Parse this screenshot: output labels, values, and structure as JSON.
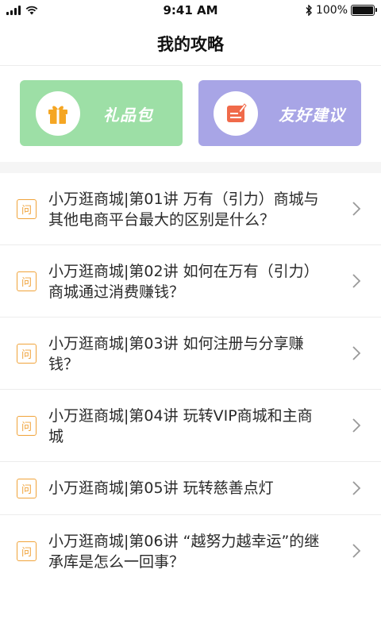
{
  "status": {
    "time": "9:41 AM",
    "battery": "100%"
  },
  "nav": {
    "title": "我的攻略"
  },
  "cards": {
    "gift": {
      "label": "礼品包",
      "icon": "gift-icon"
    },
    "suggest": {
      "label": "友好建议",
      "icon": "note-icon"
    }
  },
  "question_badge": "问",
  "colors": {
    "gift_bg": "#9ddfa6",
    "suggest_bg": "#a8a5e6",
    "accent": "#f0a33a",
    "note_icon": "#f06a4a"
  },
  "articles": [
    {
      "lines": [
        "小万逛商城|第01讲 万有（引力）商城与",
        "其他电商平台最大的区别是什么？"
      ]
    },
    {
      "lines": [
        "小万逛商城|第02讲 如何在万有（引力）",
        "商城通过消费赚钱？"
      ]
    },
    {
      "lines": [
        "小万逛商城|第03讲 如何注册与分享赚",
        "钱？"
      ]
    },
    {
      "lines": [
        "小万逛商城|第04讲 玩转VIP商城和主商",
        "城"
      ]
    },
    {
      "lines": [
        "小万逛商城|第05讲 玩转慈善点灯"
      ]
    },
    {
      "lines": [
        "小万逛商城|第06讲 “越努力越幸运”的继",
        "承库是怎么一回事？"
      ]
    }
  ]
}
